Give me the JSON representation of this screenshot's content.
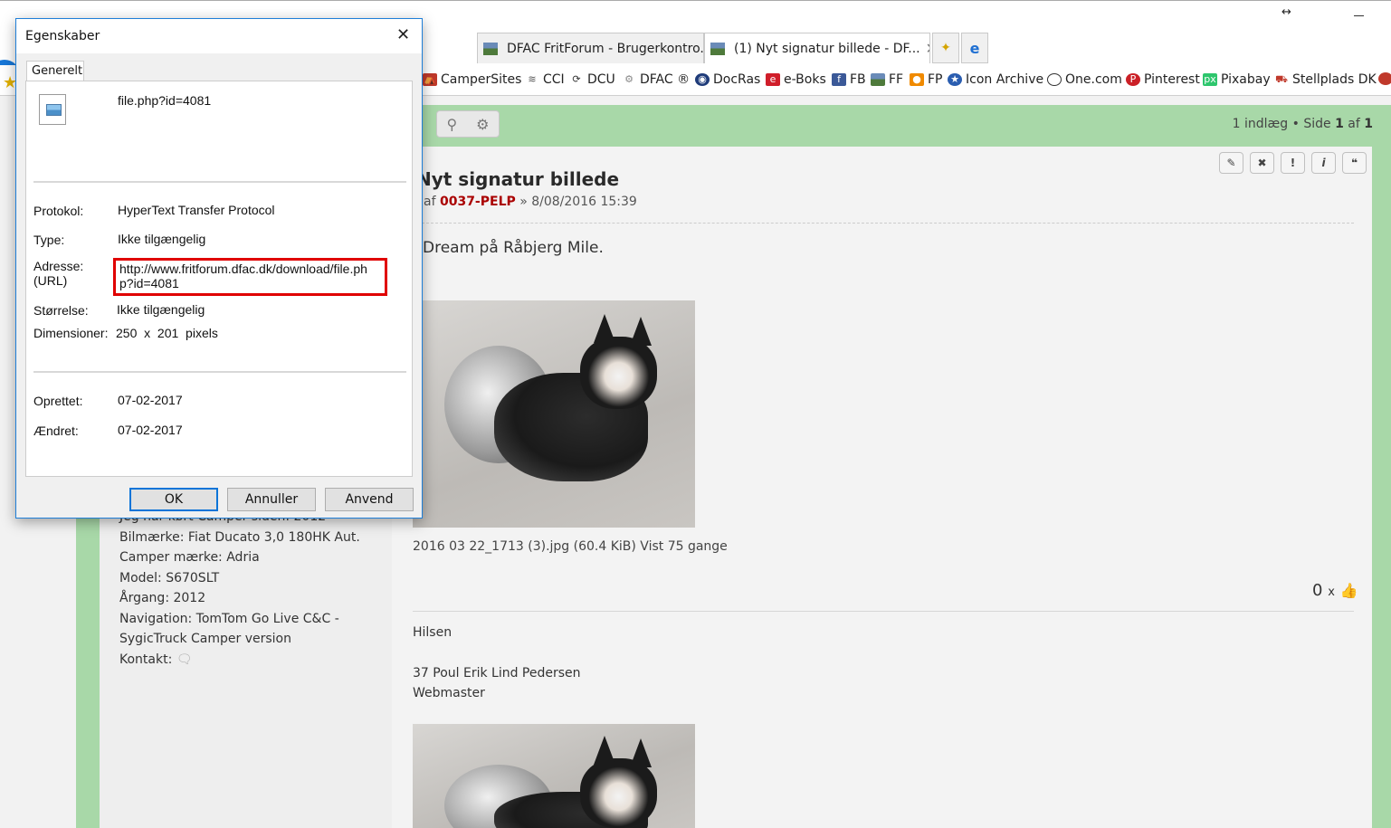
{
  "browser": {
    "tabs": [
      {
        "label": "DFAC FritForum - Brugerkontro..."
      },
      {
        "label": "(1) Nyt signatur billede - DF..."
      }
    ],
    "favorites": [
      {
        "label": "CamperSites"
      },
      {
        "label": "CCI"
      },
      {
        "label": "DCU"
      },
      {
        "label": "DFAC ®"
      },
      {
        "label": "DocRas"
      },
      {
        "label": "e-Boks"
      },
      {
        "label": "FB"
      },
      {
        "label": "FF"
      },
      {
        "label": "FP"
      },
      {
        "label": "Icon Archive"
      },
      {
        "label": "One.com"
      },
      {
        "label": "Pinterest"
      },
      {
        "label": "Pixabay"
      },
      {
        "label": "Stellplads DK"
      }
    ]
  },
  "forum": {
    "pagination_prefix": "1 indlæg • Side",
    "page_current": "1",
    "page_of": "af",
    "page_total": "1",
    "post": {
      "title": "Nyt signatur billede",
      "meta_prefix": "af",
      "author": "0037-PELP",
      "meta_suffix": "» 8/08/2016 15:39",
      "text": "Dream på Råbjerg Mile.",
      "attachment_caption": "2016 03 22_1713 (3).jpg (60.4 KiB) Vist 75 gange",
      "likes_count": "0",
      "likes_x": "x",
      "signature_greeting": "Hilsen",
      "signature_name": "37 Poul Erik Lind Pedersen",
      "signature_role": "Webmaster"
    },
    "profile": {
      "camper_since": "Jeg har kørt Camper siden: 2012",
      "car_make": "Bilmærke: Fiat Ducato 3,0 180HK Aut.",
      "camper_brand": "Camper mærke: Adria",
      "model": "Model: S670SLT",
      "year": "Årgang: 2012",
      "navigation_1": "Navigation: TomTom Go Live C&C -",
      "navigation_2": "SygicTruck Camper version",
      "contact": "Kontakt:"
    }
  },
  "dialog": {
    "title": "Egenskaber",
    "tab": "Generelt",
    "file_name": "file.php?id=4081",
    "protocol_label": "Protokol:",
    "protocol_value": "HyperText Transfer Protocol",
    "type_label": "Type:",
    "type_value": "Ikke tilgængelig",
    "address_label_1": "Adresse:",
    "address_label_2": "(URL)",
    "address_value": "http://www.fritforum.dfac.dk/download/file.php?id=4081",
    "size_label": "Størrelse:",
    "size_value": "Ikke tilgængelig",
    "dimensions_label": "Dimensioner:",
    "dimensions_value": "250  x  201  pixels",
    "created_label": "Oprettet:",
    "created_value": "07-02-2017",
    "modified_label": "Ændret:",
    "modified_value": "07-02-2017",
    "buttons": {
      "ok": "OK",
      "cancel": "Annuller",
      "apply": "Anvend"
    }
  }
}
